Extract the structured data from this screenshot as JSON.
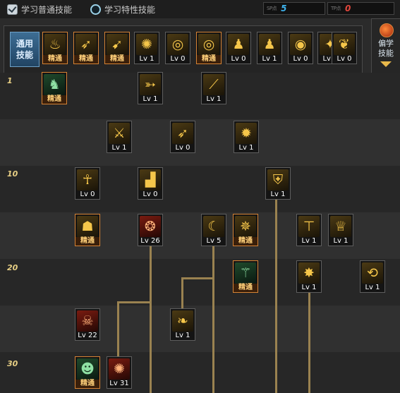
{
  "topbar": {
    "learn_common": "学习普通技能",
    "learn_special": "学习特性技能",
    "sp_a_tag": "SP点",
    "sp_a_value": "5",
    "sp_b_tag": "TP点",
    "sp_b_value": "0",
    "colors": {
      "sp_a": "#3fb4ef",
      "sp_b": "#e0463c"
    }
  },
  "common_bar": {
    "label_line1": "通用",
    "label_line2": "技能",
    "items": [
      {
        "icon": "rest-icon",
        "caption": "精通",
        "elite": true
      },
      {
        "icon": "leap-icon",
        "caption": "精通",
        "elite": true
      },
      {
        "icon": "dash-icon",
        "caption": "精通",
        "elite": true
      },
      {
        "icon": "wings-icon",
        "caption": "Lv 1",
        "elite": false
      },
      {
        "icon": "target-icon",
        "caption": "Lv 0",
        "elite": false
      },
      {
        "icon": "target-icon",
        "caption": "精通",
        "elite": true
      },
      {
        "icon": "figure-icon",
        "caption": "Lv 0",
        "elite": false
      },
      {
        "icon": "figure-icon",
        "caption": "Lv 1",
        "elite": false
      },
      {
        "icon": "eye-icon",
        "caption": "Lv 0",
        "elite": false
      },
      {
        "icon": "aura-icon",
        "caption": "Lv 0",
        "elite": false
      },
      {
        "icon": "mantle-icon",
        "caption": "Lv 0",
        "elite": false
      }
    ]
  },
  "side_tab": {
    "line1": "偏学",
    "line2": "技能"
  },
  "tree": {
    "level_labels": [
      "1",
      "10",
      "20",
      "30"
    ],
    "skills": [
      {
        "icon": "ninja-icon",
        "caption": "精通",
        "elite": true,
        "tint": "green"
      },
      {
        "icon": "strike-icon",
        "caption": "Lv 1",
        "elite": false
      },
      {
        "icon": "slash-icon",
        "caption": "Lv 1",
        "elite": false
      },
      {
        "icon": "sword-icon",
        "caption": "Lv 1",
        "elite": false
      },
      {
        "icon": "kick-icon",
        "caption": "Lv 0",
        "elite": false
      },
      {
        "icon": "spin-icon",
        "caption": "Lv 1",
        "elite": false
      },
      {
        "icon": "ankh-icon",
        "caption": "Lv 0",
        "elite": false
      },
      {
        "icon": "boot-icon",
        "caption": "Lv 0",
        "elite": false
      },
      {
        "icon": "shield-icon",
        "caption": "Lv 1",
        "elite": false
      },
      {
        "icon": "mask-icon",
        "caption": "精通",
        "elite": true
      },
      {
        "icon": "orb-icon",
        "caption": "Lv 26",
        "elite": false,
        "tint": "red"
      },
      {
        "icon": "arc-icon",
        "caption": "Lv 5",
        "elite": false
      },
      {
        "icon": "burst-icon",
        "caption": "精通",
        "elite": true
      },
      {
        "icon": "anvil-icon",
        "caption": "Lv 1",
        "elite": false
      },
      {
        "icon": "crown-icon",
        "caption": "Lv 1",
        "elite": false
      },
      {
        "icon": "scythe-icon",
        "caption": "精通",
        "elite": true,
        "tint": "green"
      },
      {
        "icon": "explosion-icon",
        "caption": "Lv 1",
        "elite": false
      },
      {
        "icon": "swirl-icon",
        "caption": "Lv 1",
        "elite": false
      },
      {
        "icon": "demon-icon",
        "caption": "Lv 22",
        "elite": false,
        "tint": "red"
      },
      {
        "icon": "phoenix-icon",
        "caption": "Lv 1",
        "elite": false
      },
      {
        "icon": "silhouette-icon",
        "caption": "精通",
        "elite": true,
        "tint": "green"
      },
      {
        "icon": "blast-icon",
        "caption": "Lv 31",
        "elite": false,
        "tint": "red"
      }
    ]
  }
}
